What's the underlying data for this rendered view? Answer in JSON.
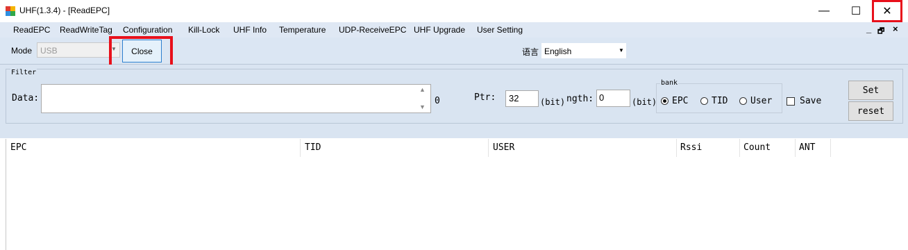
{
  "window": {
    "title": "UHF(1.3.4) - [ReadEPC]",
    "minimize": "—",
    "maximize": "☐",
    "close": "✕"
  },
  "menu": {
    "items": [
      "ReadEPC",
      "ReadWriteTag",
      "Configuration",
      "Kill-Lock",
      "UHF Info",
      "Temperature",
      "UDP-ReceiveEPC",
      "UHF Upgrade",
      "User Setting"
    ],
    "mdi_minimize": "_",
    "mdi_restore": "🗗",
    "mdi_close": "×"
  },
  "toolbar": {
    "mode_label": "Mode",
    "mode_value": "USB",
    "close_button": "Close",
    "language_label": "语言",
    "language_value": "English"
  },
  "filter": {
    "legend": "Filter",
    "data_label": "Data:",
    "data_value": "",
    "data_length": "0",
    "ptr_label": "Ptr:",
    "ptr_value": "32",
    "ptr_unit": "(bit)",
    "length_label": "ngth:",
    "length_value": "0",
    "length_unit": "(bit)",
    "bank_legend": "bank",
    "bank_options": [
      "EPC",
      "TID",
      "User"
    ],
    "bank_selected": "EPC",
    "save_label": "Save",
    "save_checked": false,
    "set_button": "Set",
    "reset_button": "reset"
  },
  "table": {
    "columns": [
      "EPC",
      "TID",
      "USER",
      "Rssi",
      "Count",
      "ANT"
    ],
    "rows": []
  },
  "colors": {
    "highlight": "#e8101b",
    "menu_background": "#dfe8f4",
    "panel_background": "#d9e4f1"
  }
}
